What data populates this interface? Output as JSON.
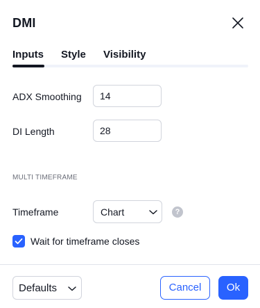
{
  "dialog": {
    "title": "DMI",
    "close_icon": "close-icon"
  },
  "tabs": [
    {
      "label": "Inputs",
      "active": true
    },
    {
      "label": "Style",
      "active": false
    },
    {
      "label": "Visibility",
      "active": false
    }
  ],
  "inputs": {
    "adx_smoothing": {
      "label": "ADX Smoothing",
      "value": "14"
    },
    "di_length": {
      "label": "DI Length",
      "value": "28"
    }
  },
  "multi_timeframe": {
    "section_title": "MULTI TIMEFRAME",
    "timeframe": {
      "label": "Timeframe",
      "value": "Chart"
    },
    "help_icon": "question-mark-icon",
    "wait_closes": {
      "label": "Wait for timeframe closes",
      "checked": true
    }
  },
  "footer": {
    "defaults_label": "Defaults",
    "cancel_label": "Cancel",
    "ok_label": "Ok"
  },
  "colors": {
    "accent": "#2962ff",
    "text": "#131722",
    "border": "#d1d4dc",
    "muted": "#6a6d78"
  }
}
